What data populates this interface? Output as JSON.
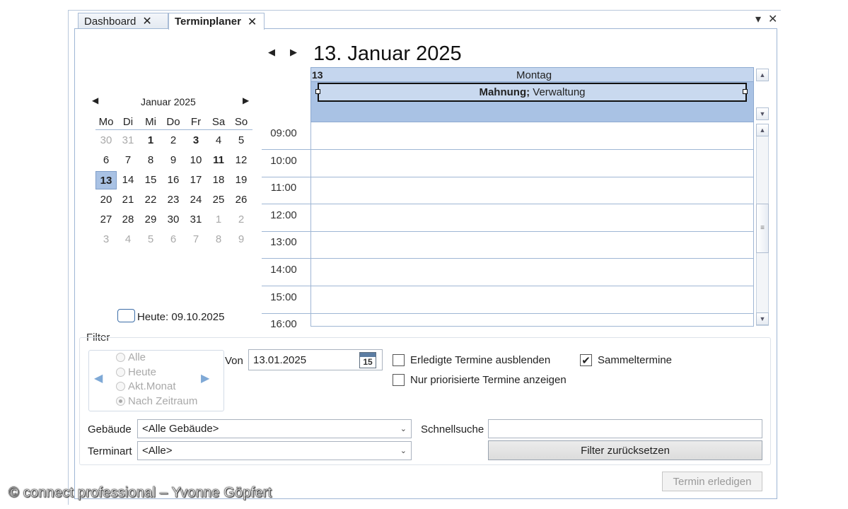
{
  "tabs": [
    {
      "label": "Dashboard",
      "close": "✕"
    },
    {
      "label": "Terminplaner",
      "close": "✕"
    }
  ],
  "window_controls": {
    "menu": "▾",
    "close": "✕"
  },
  "day_view": {
    "title": "13. Januar 2025",
    "day_number": "13",
    "weekday": "Montag",
    "appointment": {
      "bold": "Mahnung;",
      "rest": " Verwaltung"
    },
    "hours": [
      "09:00",
      "10:00",
      "11:00",
      "12:00",
      "13:00",
      "14:00",
      "15:00",
      "16:00"
    ]
  },
  "mini_calendar": {
    "month_label": "Januar 2025",
    "weekdays": [
      "Mo",
      "Di",
      "Mi",
      "Do",
      "Fr",
      "Sa",
      "So"
    ],
    "weeks": [
      [
        {
          "d": "30",
          "g": true
        },
        {
          "d": "31",
          "g": true
        },
        {
          "d": "1",
          "b": true
        },
        {
          "d": "2"
        },
        {
          "d": "3",
          "b": true
        },
        {
          "d": "4"
        },
        {
          "d": "5"
        }
      ],
      [
        {
          "d": "6"
        },
        {
          "d": "7"
        },
        {
          "d": "8"
        },
        {
          "d": "9"
        },
        {
          "d": "10"
        },
        {
          "d": "11",
          "b": true
        },
        {
          "d": "12"
        }
      ],
      [
        {
          "d": "13",
          "s": true
        },
        {
          "d": "14"
        },
        {
          "d": "15"
        },
        {
          "d": "16"
        },
        {
          "d": "17"
        },
        {
          "d": "18"
        },
        {
          "d": "19"
        }
      ],
      [
        {
          "d": "20"
        },
        {
          "d": "21"
        },
        {
          "d": "22"
        },
        {
          "d": "23"
        },
        {
          "d": "24"
        },
        {
          "d": "25"
        },
        {
          "d": "26"
        }
      ],
      [
        {
          "d": "27"
        },
        {
          "d": "28"
        },
        {
          "d": "29"
        },
        {
          "d": "30"
        },
        {
          "d": "31"
        },
        {
          "d": "1",
          "g": true
        },
        {
          "d": "2",
          "g": true
        }
      ],
      [
        {
          "d": "3",
          "g": true
        },
        {
          "d": "4",
          "g": true
        },
        {
          "d": "5",
          "g": true
        },
        {
          "d": "6",
          "g": true
        },
        {
          "d": "7",
          "g": true
        },
        {
          "d": "8",
          "g": true
        },
        {
          "d": "9",
          "g": true
        }
      ]
    ],
    "today_label": "Heute: 09.10.2025"
  },
  "filter": {
    "legend": "Filter",
    "radio_options": [
      {
        "label": "Alle",
        "selected": false
      },
      {
        "label": "Heute",
        "selected": false
      },
      {
        "label": "Akt.Monat",
        "selected": false
      },
      {
        "label": "Nach Zeitraum",
        "selected": true
      }
    ],
    "von_label": "Von",
    "von_value": "13.01.2025",
    "calendar_icon_number": "15",
    "checkboxes": {
      "erledigte": {
        "label": "Erledigte Termine ausblenden",
        "checked": false
      },
      "priorisiert": {
        "label": "Nur priorisierte Termine anzeigen",
        "checked": false
      },
      "sammel": {
        "label": "Sammeltermine",
        "checked": true
      }
    },
    "gebaeude_label": "Gebäude",
    "gebaeude_value": "<Alle Gebäude>",
    "terminart_label": "Terminart",
    "terminart_value": "<Alle>",
    "schnellsuche_label": "Schnellsuche",
    "schnellsuche_value": "",
    "reset_label": "Filter zurücksetzen"
  },
  "termin_erledigen_label": "Termin erledigen",
  "watermark": "© connect professional – Yvonne Göpfert",
  "colors": {
    "accent": "#a9c2e4",
    "appointment_bg": "#c9d9ef",
    "border": "#9fb6d4"
  }
}
